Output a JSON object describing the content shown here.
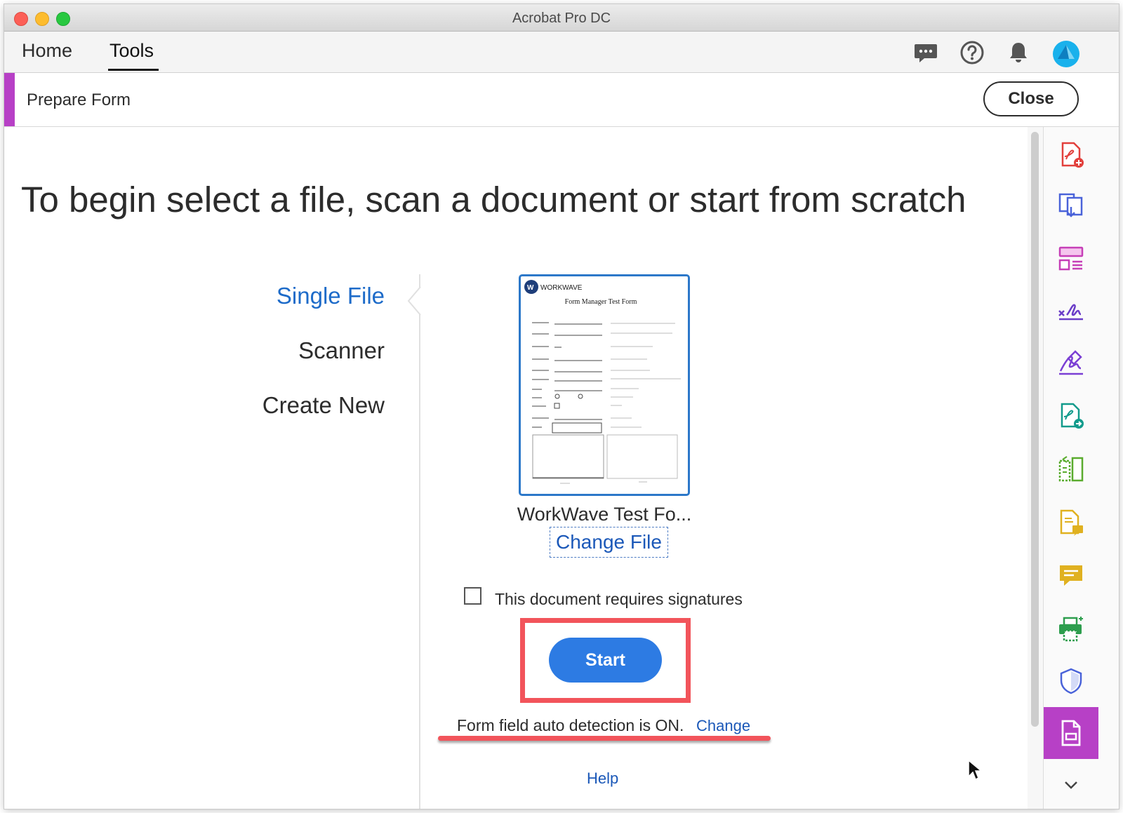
{
  "window": {
    "title": "Acrobat Pro DC"
  },
  "menubar": {
    "tabs": [
      {
        "label": "Home",
        "active": false
      },
      {
        "label": "Tools",
        "active": true
      }
    ],
    "icons": [
      "chat-icon",
      "help-icon",
      "bell-icon",
      "account-avatar"
    ]
  },
  "tool_header": {
    "title": "Prepare Form",
    "close_label": "Close",
    "accent_color": "#b740c6"
  },
  "main": {
    "headline": "To begin select a file, scan a document or start from scratch",
    "options": [
      {
        "label": "Single File",
        "selected": true
      },
      {
        "label": "Scanner",
        "selected": false
      },
      {
        "label": "Create New",
        "selected": false
      }
    ],
    "file": {
      "name": "WorkWave Test Fo...",
      "change_label": "Change File",
      "thumbnail": {
        "brand": "WORKWAVE",
        "heading": "Form Manager Test Form"
      }
    },
    "signature_checkbox": {
      "label": "This document requires signatures",
      "checked": false
    },
    "start_label": "Start",
    "detection_text": "Form field auto detection is ON.",
    "detection_change_label": "Change",
    "help_label": "Help"
  },
  "colors": {
    "link": "#1b58b8",
    "primary_button": "#2d7be3",
    "annotation": "#f2545b"
  },
  "right_pane": {
    "tools": [
      "create-pdf-icon",
      "combine-files-icon",
      "organize-pages-icon",
      "fill-sign-icon",
      "request-signatures-icon",
      "export-pdf-icon",
      "compare-files-icon",
      "comment-file-icon",
      "comment-icon",
      "print-production-icon",
      "protect-icon",
      "prepare-form-icon",
      "chevron-down-icon"
    ],
    "active_tool": "prepare-form-icon"
  }
}
